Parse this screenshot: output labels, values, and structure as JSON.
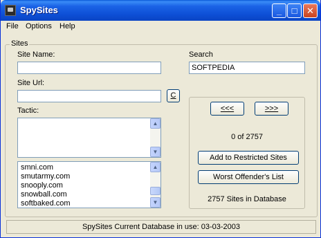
{
  "window": {
    "title": "SpySites"
  },
  "menu": {
    "items": [
      "File",
      "Options",
      "Help"
    ]
  },
  "sites_group": {
    "label": "Sites"
  },
  "form": {
    "site_name_label": "Site Name:",
    "site_name_value": "",
    "site_url_label": "Site Url:",
    "site_url_value": "",
    "c_button_label": "C",
    "tactic_label": "Tactic:",
    "tactic_value": "",
    "site_list": [
      "smni.com",
      "smutarmy.com",
      "snooply.com",
      "snowball.com",
      "softbaked.com"
    ]
  },
  "search": {
    "label": "Search",
    "value": "SOFTPEDIA",
    "prev_label": "<<<",
    "next_label": ">>>",
    "counter": "0 of 2757",
    "add_restricted_label": "Add to Restricted Sites",
    "worst_offenders_label": "Worst Offender's List",
    "sites_in_db": "2757 Sites in Database"
  },
  "status": {
    "text": "SpySites Current Database in use:  03-03-2003"
  }
}
